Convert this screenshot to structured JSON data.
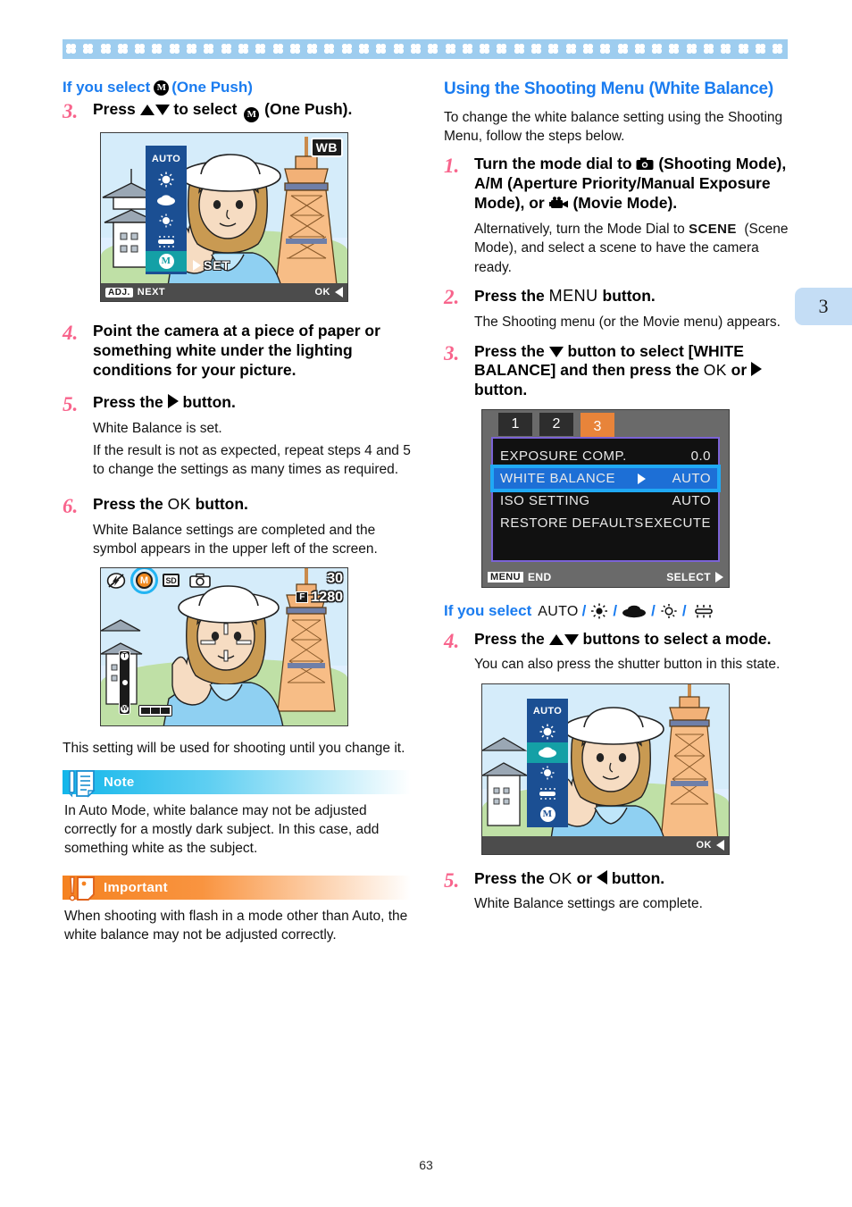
{
  "page": {
    "number": "63",
    "chapter_tab": "3"
  },
  "left": {
    "subheading": {
      "prefix": "If you select",
      "icon": "one-push-m-icon",
      "suffix": "(One Push)"
    },
    "steps": [
      {
        "num": "3.",
        "title_parts": [
          "Press ",
          "up-down-arrows",
          " to select ",
          "one-push-m-icon",
          "(One Push)."
        ],
        "title_plain": "Press ▲▼ to select (One Push)."
      },
      {
        "num": "4.",
        "title_plain": "Point the camera at a piece of paper or something white under the lighting conditions for your picture."
      },
      {
        "num": "5.",
        "title_plain": "Press the ▶ button.",
        "desc": [
          "White Balance is set.",
          "If the result is not as expected, repeat steps 4 and 5 to change the settings as many times as required."
        ]
      },
      {
        "num": "6.",
        "title_plain": "Press the OK button.",
        "desc": [
          "White Balance settings are completed and the symbol appears in the upper left of the screen."
        ]
      }
    ],
    "closing_text": "This setting will be used for shooting until you change it.",
    "note": {
      "label": "Note",
      "icon": "note-memo-icon",
      "text": "In Auto Mode, white balance may not be adjusted correctly for a mostly dark subject. In this case, add something white as the subject."
    },
    "important": {
      "label": "Important",
      "icon": "important-exclamation-icon",
      "text": "When shooting with flash in a mode other than Auto, the white balance may not be adjusted correctly."
    },
    "lcd_one_push": {
      "wb_badge": "WB",
      "set_label": "SET",
      "bar_left_chip": "ADJ.",
      "bar_left": "NEXT",
      "bar_right": "OK",
      "wb_options": [
        "AUTO",
        "daylight-sun-icon",
        "overcast-cloud-icon",
        "tungsten-lamp-icon",
        "fluorescent-tube-icon",
        "one-push-m-icon"
      ],
      "selected_index": 5
    },
    "lcd_result": {
      "status_icons": [
        "flash-off-icon",
        "one-push-m-icon",
        "SD",
        "camera-icon"
      ],
      "selected_status_index": 1,
      "shots_remaining": "30",
      "quality_badge": "F",
      "image_size": "1280",
      "zoom_top": "T",
      "zoom_bottom": "W"
    }
  },
  "right": {
    "heading": "Using the Shooting Menu (White Balance)",
    "intro": "To change the white balance setting using the Shooting Menu, follow the steps below.",
    "steps": [
      {
        "num": "1.",
        "title_plain": "Turn the mode dial to (Shooting Mode), A/M (Aperture Priority/Manual Exposure Mode), or (Movie Mode).",
        "desc": [
          "Alternatively, turn the Mode Dial to SCENE (Scene Mode), and select a scene to have the camera ready."
        ]
      },
      {
        "num": "2.",
        "title_plain": "Press the MENU button.",
        "desc": [
          "The Shooting menu (or the Movie menu) appears."
        ]
      },
      {
        "num": "3.",
        "title_plain": "Press the ▼ button to select [WHITE BALANCE] and then press the OK or ▶ button."
      },
      {
        "num": "4.",
        "title_plain": "Press the ▲▼ buttons to select a mode.",
        "desc": [
          "You can also press the shutter button in this state."
        ]
      },
      {
        "num": "5.",
        "title_plain": "Press the OK or ◀ button.",
        "desc": [
          "White Balance settings are complete."
        ]
      }
    ],
    "subheading": {
      "prefix": "If you select",
      "options": [
        "AUTO",
        "daylight-sun-icon",
        "overcast-cloud-icon",
        "tungsten-lamp-icon",
        "fluorescent-tube-icon"
      ],
      "separator": "/"
    },
    "osd_menu": {
      "tabs": [
        "1",
        "2",
        "3"
      ],
      "active_tab_index": 2,
      "rows": [
        {
          "label": "EXPOSURE COMP.",
          "value": "0.0",
          "selected": false
        },
        {
          "label": "WHITE BALANCE",
          "value": "AUTO",
          "selected": true
        },
        {
          "label": "ISO SETTING",
          "value": "AUTO",
          "selected": false
        },
        {
          "label": "RESTORE DEFAULTS",
          "value": "EXECUTE",
          "selected": false
        }
      ],
      "foot_left_chip": "MENU",
      "foot_left": "END",
      "foot_right": "SELECT"
    },
    "lcd_mode_select": {
      "bar_right": "OK",
      "wb_options": [
        "AUTO",
        "daylight-sun-icon",
        "overcast-cloud-icon",
        "tungsten-lamp-icon",
        "fluorescent-tube-icon",
        "one-push-m-icon"
      ],
      "selected_index": 2
    }
  },
  "colors": {
    "accent_blue": "#1a7cf0",
    "step_pink": "#f8648c",
    "note_cyan": "#12b6ea",
    "important_orange": "#f58220",
    "tab_blue": "#c4ddf5",
    "band_blue": "#9ecdef"
  }
}
